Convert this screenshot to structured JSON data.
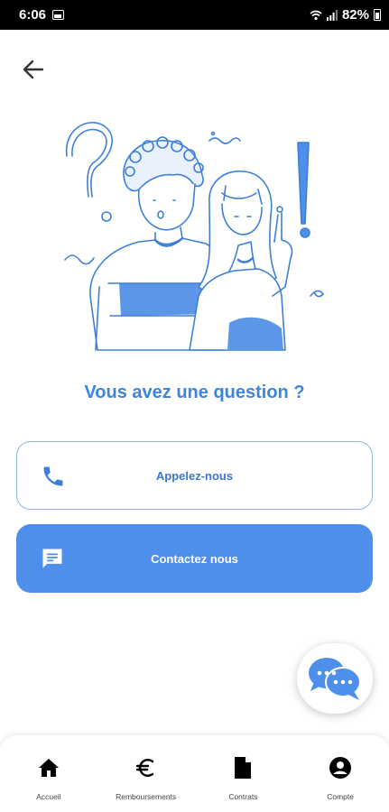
{
  "status_bar": {
    "time": "6:06",
    "battery": "82%"
  },
  "heading": "Vous avez une question ?",
  "actions": {
    "call_label": "Appelez-nous",
    "contact_label": "Contactez nous"
  },
  "nav": {
    "items": [
      {
        "label": "Accueil",
        "icon": "home-icon"
      },
      {
        "label": "Remboursements",
        "icon": "euro-icon"
      },
      {
        "label": "Contrats",
        "icon": "document-icon"
      },
      {
        "label": "Compte",
        "icon": "account-icon"
      }
    ]
  },
  "colors": {
    "accent": "#4d8fea",
    "heading": "#3d85e0",
    "card_border": "#8db5ea"
  }
}
